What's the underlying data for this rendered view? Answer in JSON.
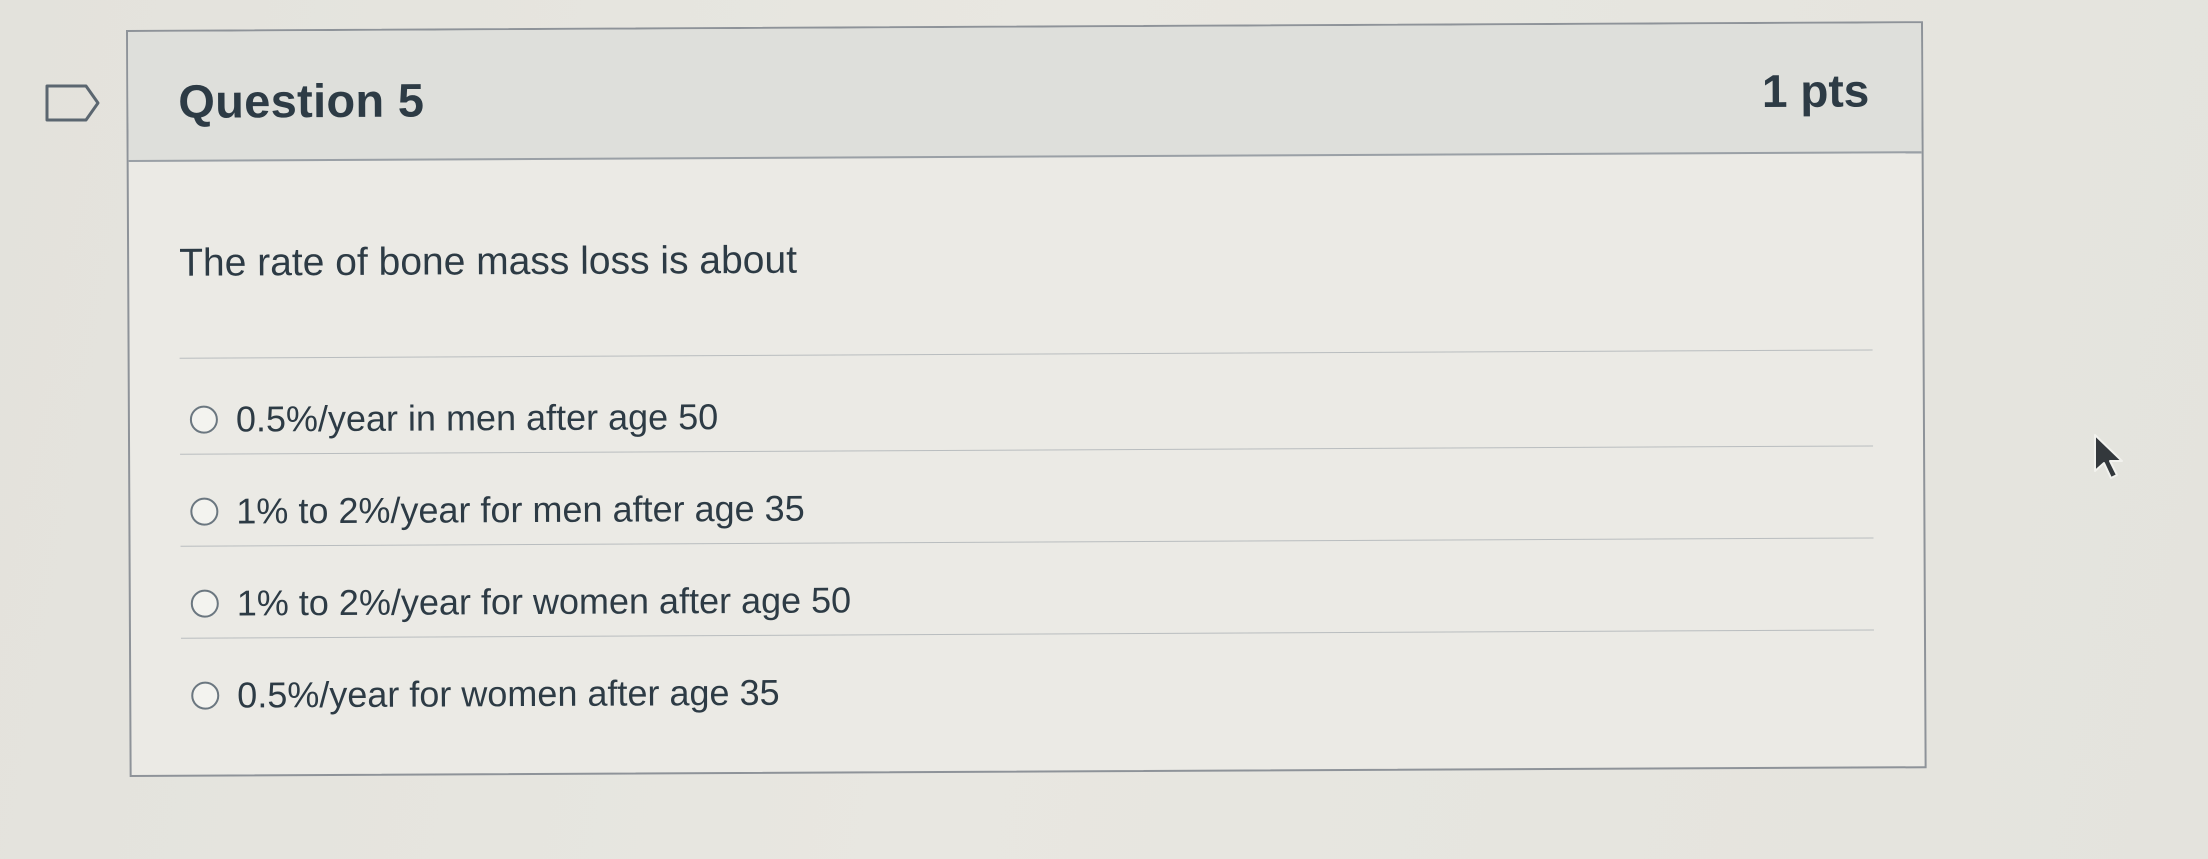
{
  "question": {
    "title": "Question 5",
    "points": "1 pts",
    "text": "The rate of bone mass loss is about"
  },
  "answers": [
    {
      "label": "0.5%/year in men after age 50",
      "selected": false
    },
    {
      "label": "1% to 2%/year for men after age 35",
      "selected": false
    },
    {
      "label": "1% to 2%/year for women after age 50",
      "selected": false
    },
    {
      "label": "0.5%/year for women after age 35",
      "selected": false
    }
  ],
  "icons": {
    "flag": "flag-icon",
    "radio": "radio-empty-icon",
    "cursor": "mouse-pointer-icon"
  }
}
